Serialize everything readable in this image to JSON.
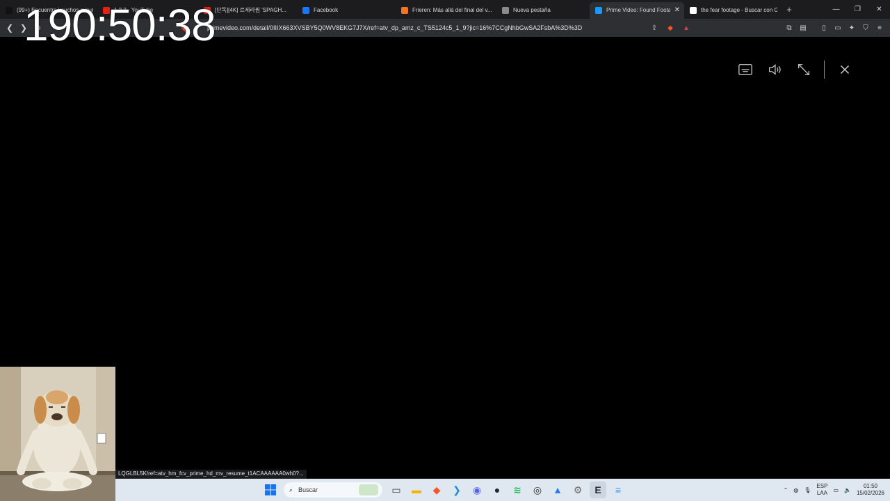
{
  "browser": {
    "tabs": [
      {
        "title": "(99+) Encuentra 'muchos minut...",
        "favicon": "tiktok-icon",
        "color": "#111111",
        "active": false
      },
      {
        "title": "1 2 3 - YouTube",
        "favicon": "youtube-icon",
        "color": "#e62117",
        "active": false
      },
      {
        "title": "[단독][4K] 르세라핌 'SPAGH...",
        "favicon": "youtube-icon",
        "color": "#e62117",
        "active": false
      },
      {
        "title": "Facebook",
        "favicon": "facebook-icon",
        "color": "#1877f2",
        "active": false
      },
      {
        "title": "Frieren: Más allá del final del v...",
        "favicon": "crunchyroll-icon",
        "color": "#f47521",
        "active": false
      },
      {
        "title": "Nueva pestaña",
        "favicon": "shield-icon",
        "color": "#8a8a8a",
        "active": false
      },
      {
        "title": "Prime Video: Found Footage",
        "favicon": "prime-video-icon",
        "color": "#1a98ff",
        "active": true
      },
      {
        "title": "the fear footage - Buscar con G...",
        "favicon": "google-icon",
        "color": "#ffffff",
        "active": false
      }
    ],
    "new_tab_label": "+",
    "url": "primevideo.com/detail/0IIIX663XVSBY5Q0WV8EKG7J7X/ref=atv_dp_amz_c_TS5124c5_1_9?jic=16%7CCgNhbGwSA2FsbA%3D%3D"
  },
  "overlay_clock": "190:50:38",
  "player": {
    "controls": [
      "subtitles-icon",
      "volume-icon",
      "exit-fullscreen-icon",
      "close-icon"
    ]
  },
  "status_link": "LQGLBL5K/ref=atv_hm_fcv_prime_hd_mv_resume_t1ACAAAAAA0wh0?...",
  "taskbar": {
    "search_placeholder": "Buscar",
    "apps": [
      {
        "name": "task-view",
        "color": "#444444",
        "glyph": "▭"
      },
      {
        "name": "file-explorer",
        "color": "#f4b400",
        "glyph": "▬"
      },
      {
        "name": "brave-browser",
        "color": "#fb542b",
        "glyph": "◆"
      },
      {
        "name": "vscode",
        "color": "#1f8ad2",
        "glyph": "❯"
      },
      {
        "name": "discord",
        "color": "#5865f2",
        "glyph": "◉"
      },
      {
        "name": "steam",
        "color": "#1b2838",
        "glyph": "●"
      },
      {
        "name": "spotify",
        "color": "#1db954",
        "glyph": "≋"
      },
      {
        "name": "github-desktop",
        "color": "#333333",
        "glyph": "◎"
      },
      {
        "name": "photo-editor",
        "color": "#2b7de9",
        "glyph": "▲"
      },
      {
        "name": "settings",
        "color": "#6b6b6b",
        "glyph": "⚙"
      },
      {
        "name": "epic-games",
        "color": "#2a2a2a",
        "glyph": "E",
        "active": true
      },
      {
        "name": "notepad",
        "color": "#3a96dd",
        "glyph": "≡"
      }
    ],
    "tray": {
      "lang_top": "ESP",
      "lang_bottom": "LAA",
      "time": "01:50",
      "date": "15/02/2026"
    }
  }
}
